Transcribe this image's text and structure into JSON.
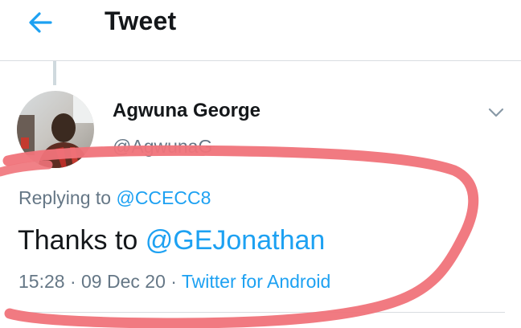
{
  "header": {
    "title": "Tweet",
    "back_icon": "arrow-left-icon"
  },
  "tweet": {
    "author_name": "Agwuna George",
    "author_handle": "@AgwunaG",
    "replying_prefix": "Replying to ",
    "replying_to": "@CCECC8",
    "text_prefix": "Thanks to ",
    "text_mention": "@GEJonathan",
    "time": "15:28",
    "separator": " · ",
    "date": "09 Dec 20",
    "source": "Twitter for Android"
  },
  "colors": {
    "accent": "#1da1f2",
    "text_primary": "#14171a",
    "text_secondary": "#657786",
    "annotation": "#f0737a"
  }
}
